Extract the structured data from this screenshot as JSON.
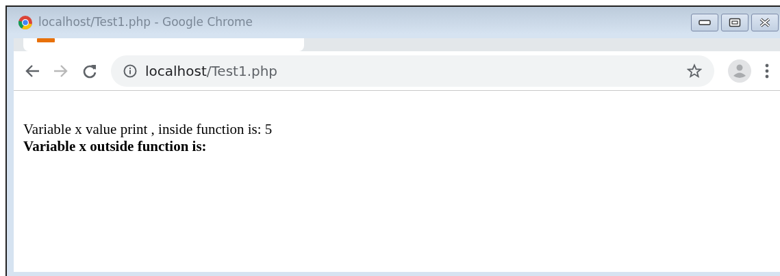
{
  "window": {
    "title": "localhost/Test1.php - Google Chrome"
  },
  "address_bar": {
    "host": "localhost",
    "path": "/Test1.php"
  },
  "page": {
    "lines": [
      {
        "text": "Variable x value print , inside function is: 5",
        "bold": false
      },
      {
        "text": "Variable x outside function is:",
        "bold": true
      }
    ]
  }
}
